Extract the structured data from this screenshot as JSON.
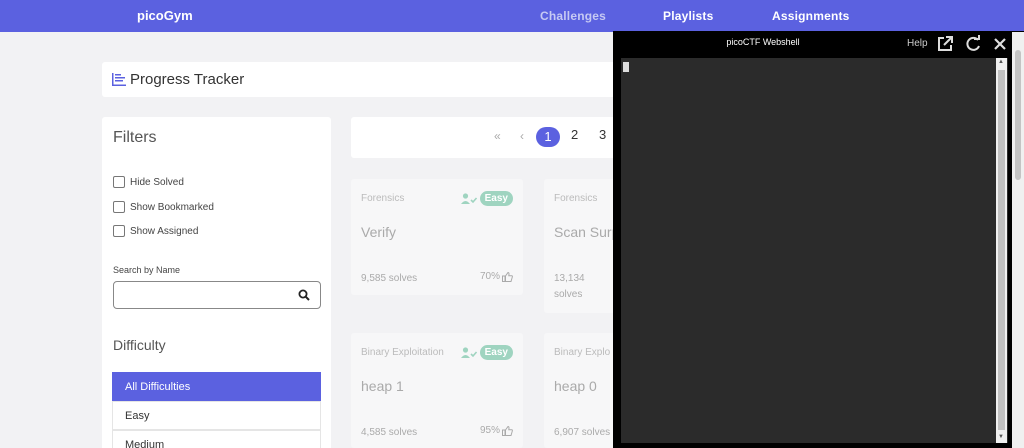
{
  "nav": {
    "brand": "picoGym",
    "links": [
      "Challenges",
      "Playlists",
      "Assignments"
    ]
  },
  "progress": {
    "title": "Progress Tracker"
  },
  "filters": {
    "title": "Filters",
    "checkboxes": [
      "Hide Solved",
      "Show Bookmarked",
      "Show Assigned"
    ],
    "search_label": "Search by Name",
    "search_value": "",
    "difficulty_title": "Difficulty",
    "difficulties": [
      "All Difficulties",
      "Easy",
      "Medium"
    ],
    "selected_difficulty": "All Difficulties"
  },
  "pagination": {
    "first": "«",
    "prev": "‹",
    "pages": [
      "1",
      "2",
      "3"
    ],
    "current": "1"
  },
  "challenges": [
    {
      "category": "Forensics",
      "name": "Verify",
      "solves": "9,585 solves",
      "likes": "70%",
      "difficulty": "Easy"
    },
    {
      "category": "Forensics",
      "name": "Scan Surp",
      "solves_line1": "13,134",
      "solves_line2": "solves"
    },
    {
      "category": "Binary Exploitation",
      "name": "heap 1",
      "solves": "4,585 solves",
      "likes": "95%",
      "difficulty": "Easy"
    },
    {
      "category": "Binary Explo",
      "name": "heap 0",
      "solves": "6,907 solves"
    }
  ],
  "webshell": {
    "title": "picoCTF Webshell",
    "help": "Help"
  },
  "colors": {
    "accent": "#5b61e0",
    "easy_badge": "#9fd4c0",
    "terminal_bg": "#2b2b2b"
  }
}
